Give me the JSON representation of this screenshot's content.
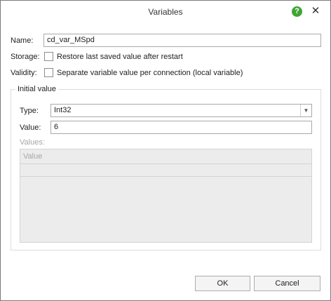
{
  "window": {
    "title": "Variables",
    "help_icon_glyph": "?",
    "close_icon_glyph": "✕"
  },
  "form": {
    "name_label": "Name:",
    "name_value": "cd_var_MSpd",
    "storage_label": "Storage:",
    "storage_checkbox_label": "Restore last saved value after restart",
    "storage_checked": false,
    "validity_label": "Validity:",
    "validity_checkbox_label": "Separate variable value per connection (local variable)",
    "validity_checked": false
  },
  "initial_value": {
    "group_title": "Initial value",
    "type_label": "Type:",
    "type_value": "Int32",
    "value_label": "Value:",
    "value_value": "6",
    "values_label": "Values:",
    "values_column_header": "Value"
  },
  "buttons": {
    "ok_label": "OK",
    "cancel_label": "Cancel"
  },
  "colors": {
    "help_icon": "#3fa535",
    "disabled_text": "#a6a6a6",
    "disabled_background": "#ececec"
  }
}
